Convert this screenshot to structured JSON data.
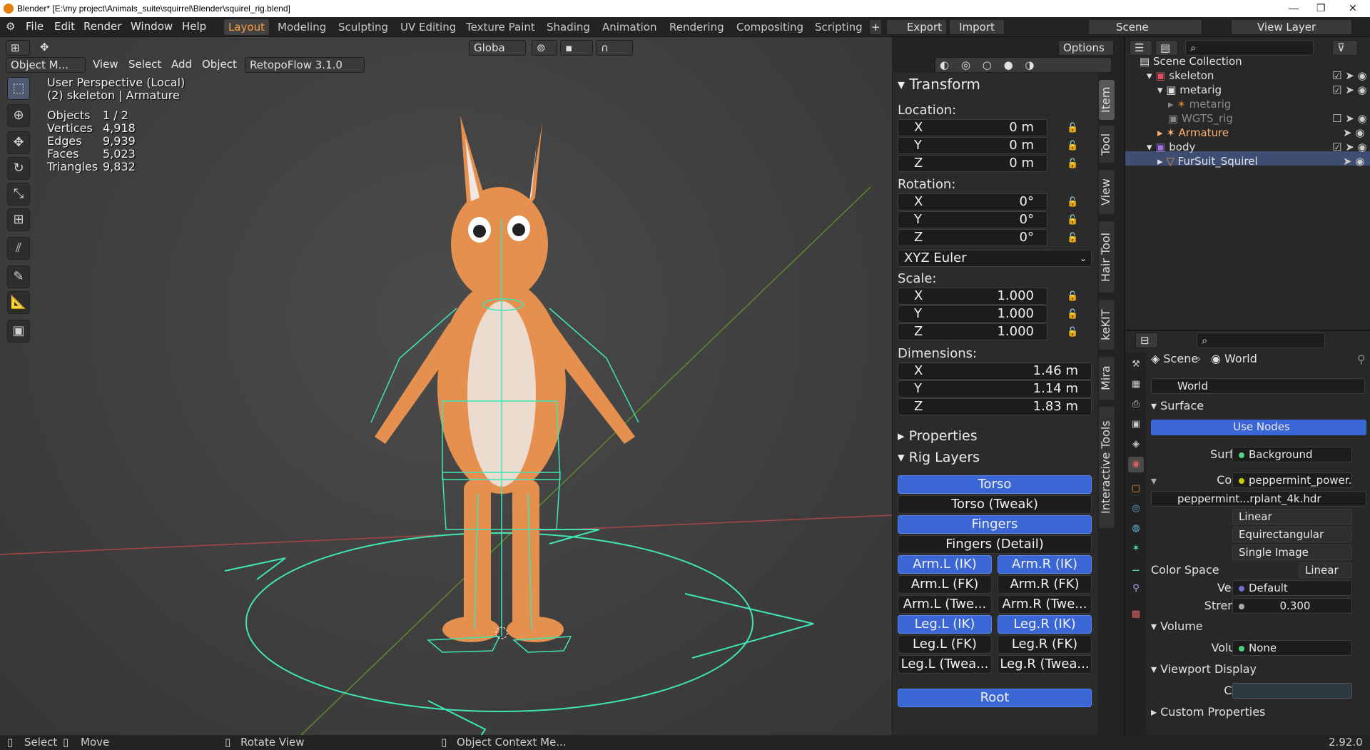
{
  "window": {
    "title": "Blender* [E:\\my project\\Animals_suite\\squirrel\\Blender\\squirel_rig.blend]",
    "min": "—",
    "max": "❐",
    "close": "✕"
  },
  "menu": [
    "File",
    "Edit",
    "Render",
    "Window",
    "Help"
  ],
  "workspaces": [
    "Layout",
    "Modeling",
    "Sculpting",
    "UV Editing",
    "Texture Paint",
    "Shading",
    "Animation",
    "Rendering",
    "Compositing",
    "Scripting"
  ],
  "topright": {
    "export": "Export",
    "import": "Import",
    "scene": "Scene",
    "view_layer": "View Layer",
    "plus": "+"
  },
  "viewport_header": {
    "mode": "Object M...",
    "items": [
      "View",
      "Select",
      "Add",
      "Object"
    ],
    "addon": "RetopoFlow 3.1.0",
    "transform": "Globa",
    "options": "Options"
  },
  "overlay": {
    "perspective": "User Perspective (Local)",
    "object": "(2) skeleton | Armature",
    "stats": [
      {
        "k": "Objects",
        "v": "1 / 2"
      },
      {
        "k": "Vertices",
        "v": "4,918"
      },
      {
        "k": "Edges",
        "v": "9,939"
      },
      {
        "k": "Faces",
        "v": "5,023"
      },
      {
        "k": "Triangles",
        "v": "9,832"
      }
    ]
  },
  "transform": {
    "title": "Transform",
    "location_label": "Location:",
    "location": [
      {
        "a": "X",
        "v": "0 m"
      },
      {
        "a": "Y",
        "v": "0 m"
      },
      {
        "a": "Z",
        "v": "0 m"
      }
    ],
    "rotation_label": "Rotation:",
    "rotation": [
      {
        "a": "X",
        "v": "0°"
      },
      {
        "a": "Y",
        "v": "0°"
      },
      {
        "a": "Z",
        "v": "0°"
      }
    ],
    "euler": "XYZ Euler",
    "scale_label": "Scale:",
    "scale": [
      {
        "a": "X",
        "v": "1.000"
      },
      {
        "a": "Y",
        "v": "1.000"
      },
      {
        "a": "Z",
        "v": "1.000"
      }
    ],
    "dimensions_label": "Dimensions:",
    "dimensions": [
      {
        "a": "X",
        "v": "1.46 m"
      },
      {
        "a": "Y",
        "v": "1.14 m"
      },
      {
        "a": "Z",
        "v": "1.83 m"
      }
    ]
  },
  "panels": {
    "properties": "Properties",
    "rig_layers": "Rig Layers"
  },
  "rig": {
    "torso": "Torso",
    "torso_tweak": "Torso (Tweak)",
    "fingers": "Fingers",
    "fingers_detail": "Fingers (Detail)",
    "arm_l_ik": "Arm.L (IK)",
    "arm_r_ik": "Arm.R (IK)",
    "arm_l_fk": "Arm.L (FK)",
    "arm_r_fk": "Arm.R (FK)",
    "arm_l_tw": "Arm.L (Twe...",
    "arm_r_tw": "Arm.R (Twe...",
    "leg_l_ik": "Leg.L (IK)",
    "leg_r_ik": "Leg.R (IK)",
    "leg_l_fk": "Leg.L (FK)",
    "leg_r_fk": "Leg.R (FK)",
    "leg_l_tw": "Leg.L (Twea...",
    "leg_r_tw": "Leg.R (Twea...",
    "root": "Root"
  },
  "side_tabs": [
    "Item",
    "Tool",
    "View",
    "Hair Tool",
    "keKIT",
    "Mira",
    "Interactive Tools"
  ],
  "outliner": {
    "root": "Scene Collection",
    "skeleton": "skeleton",
    "metarig_col": "metarig",
    "metarig_obj": "metarig",
    "wgts": "WGTS_rig",
    "armature": "Armature",
    "body": "body",
    "mesh": "FurSuit_Squirel"
  },
  "properties": {
    "scene": "Scene",
    "world": "World",
    "world_field": "World",
    "surface": "Surface",
    "use_nodes": "Use Nodes",
    "surface_label": "Surface",
    "surface_value": "Background",
    "color_label": "Color",
    "color_value": "peppermint_power...",
    "hdr": "peppermint...rplant_4k.hdr",
    "interp": "Linear",
    "projection": "Equirectangular",
    "source": "Single Image",
    "colorspace_label": "Color Space",
    "colorspace": "Linear",
    "vector_label": "Vector",
    "vector": "Default",
    "strength_label": "Strength",
    "strength": "0.300",
    "volume": "Volume",
    "volume_label": "Volume",
    "volume_value": "None",
    "viewport_display": "Viewport Display",
    "vd_color": "Color",
    "custom": "Custom Properties"
  },
  "status": {
    "select": "Select",
    "move": "Move",
    "rotate": "Rotate View",
    "context": "Object Context Me...",
    "version": "2.92.0"
  }
}
